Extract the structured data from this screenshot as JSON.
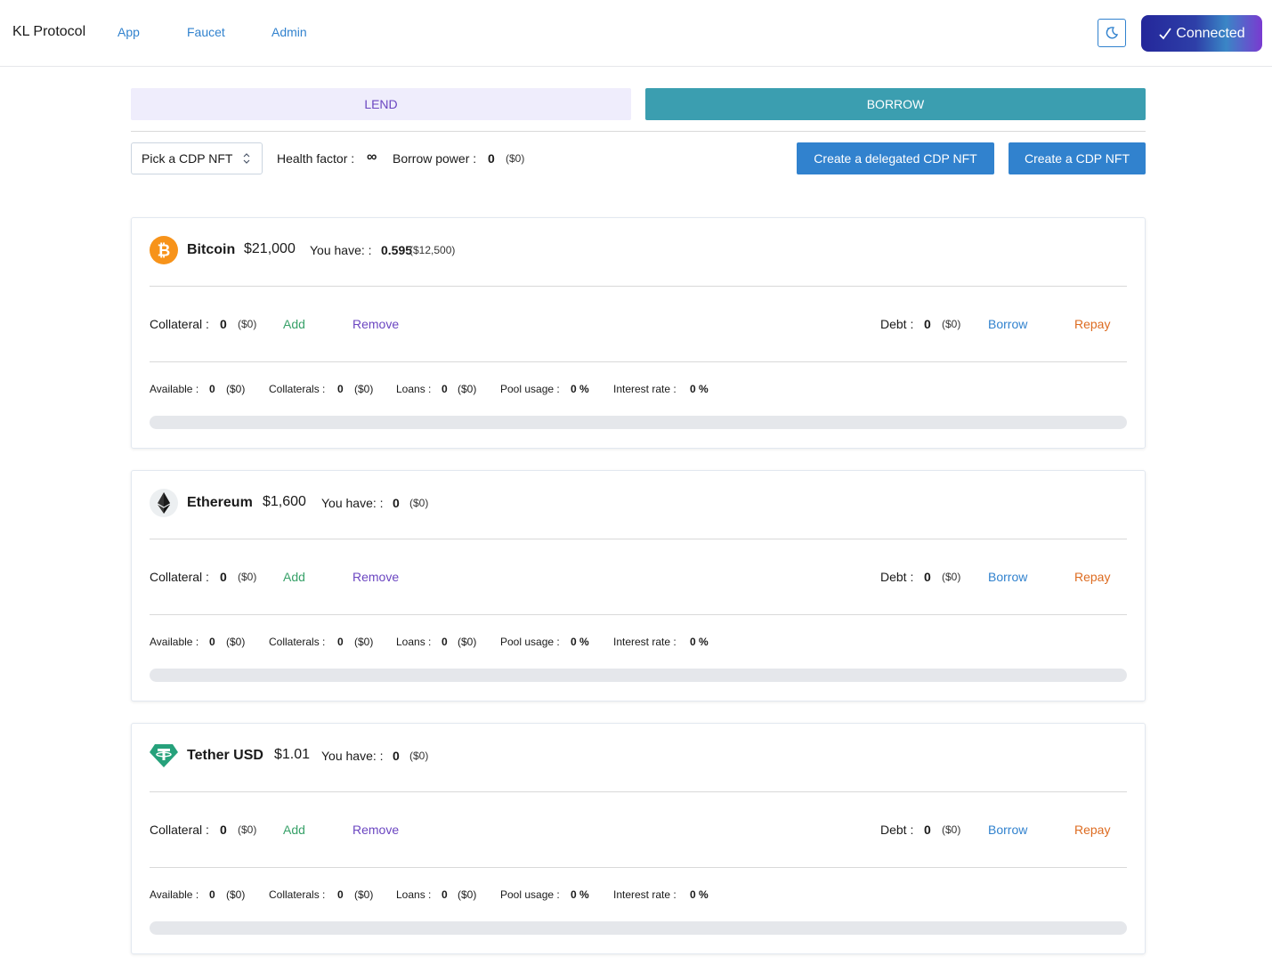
{
  "header": {
    "brand": "KL Protocol",
    "nav": [
      "App",
      "Faucet",
      "Admin"
    ],
    "connected_label": "Connected",
    "connected_icon": "check-icon",
    "theme_icon": "moon-icon"
  },
  "tabs": {
    "lend": "LEND",
    "borrow": "BORROW",
    "active": "BORROW"
  },
  "toolbar": {
    "select_value": "Pick a CDP NFT",
    "health_label": "Health factor :",
    "health_value": "∞",
    "borrow_power_label": "Borrow power :",
    "borrow_power_value": "0",
    "borrow_power_usd": "($0)",
    "delegated_btn": "Create a delegated CDP NFT",
    "create_btn": "Create a CDP NFT"
  },
  "colors": {
    "accent_blue": "#3182ce",
    "borrow_teal": "#3b9eb0",
    "lend_bg": "#efedfc",
    "add_green": "#38a169",
    "remove_purple": "#6b46c1",
    "repay_orange": "#dd6b20"
  },
  "assets": [
    {
      "name": "Bitcoin",
      "icon": "bitcoin-icon",
      "price": "$21,000",
      "have_label": "You have: :",
      "have_value": "0.595",
      "have_usd": "($12,500)",
      "collateral_label": "Collateral :",
      "collateral_value": "0",
      "collateral_usd": "($0)",
      "add": "Add",
      "remove": "Remove",
      "debt_label": "Debt :",
      "debt_value": "0",
      "debt_usd": "($0)",
      "borrow": "Borrow",
      "repay": "Repay",
      "available_label": "Available :",
      "available_value": "0",
      "available_usd": "($0)",
      "collaterals_label": "Collaterals :",
      "collaterals_value": "0",
      "collaterals_usd": "($0)",
      "loans_label": "Loans :",
      "loans_value": "0",
      "loans_usd": "($0)",
      "pool_usage_label": "Pool usage :",
      "pool_usage_value": "0 %",
      "interest_label": "Interest rate :",
      "interest_value": "0 %",
      "pool_usage_fraction": 0
    },
    {
      "name": "Ethereum",
      "icon": "ethereum-icon",
      "price": "$1,600",
      "have_label": "You have: :",
      "have_value": "0",
      "have_usd": "($0)",
      "collateral_label": "Collateral :",
      "collateral_value": "0",
      "collateral_usd": "($0)",
      "add": "Add",
      "remove": "Remove",
      "debt_label": "Debt :",
      "debt_value": "0",
      "debt_usd": "($0)",
      "borrow": "Borrow",
      "repay": "Repay",
      "available_label": "Available :",
      "available_value": "0",
      "available_usd": "($0)",
      "collaterals_label": "Collaterals :",
      "collaterals_value": "0",
      "collaterals_usd": "($0)",
      "loans_label": "Loans :",
      "loans_value": "0",
      "loans_usd": "($0)",
      "pool_usage_label": "Pool usage :",
      "pool_usage_value": "0 %",
      "interest_label": "Interest rate :",
      "interest_value": "0 %",
      "pool_usage_fraction": 0
    },
    {
      "name": "Tether USD",
      "icon": "tether-icon",
      "price": "$1.01",
      "have_label": "You have: :",
      "have_value": "0",
      "have_usd": "($0)",
      "collateral_label": "Collateral :",
      "collateral_value": "0",
      "collateral_usd": "($0)",
      "add": "Add",
      "remove": "Remove",
      "debt_label": "Debt :",
      "debt_value": "0",
      "debt_usd": "($0)",
      "borrow": "Borrow",
      "repay": "Repay",
      "available_label": "Available :",
      "available_value": "0",
      "available_usd": "($0)",
      "collaterals_label": "Collaterals :",
      "collaterals_value": "0",
      "collaterals_usd": "($0)",
      "loans_label": "Loans :",
      "loans_value": "0",
      "loans_usd": "($0)",
      "pool_usage_label": "Pool usage :",
      "pool_usage_value": "0 %",
      "interest_label": "Interest rate :",
      "interest_value": "0 %",
      "pool_usage_fraction": 0
    }
  ]
}
